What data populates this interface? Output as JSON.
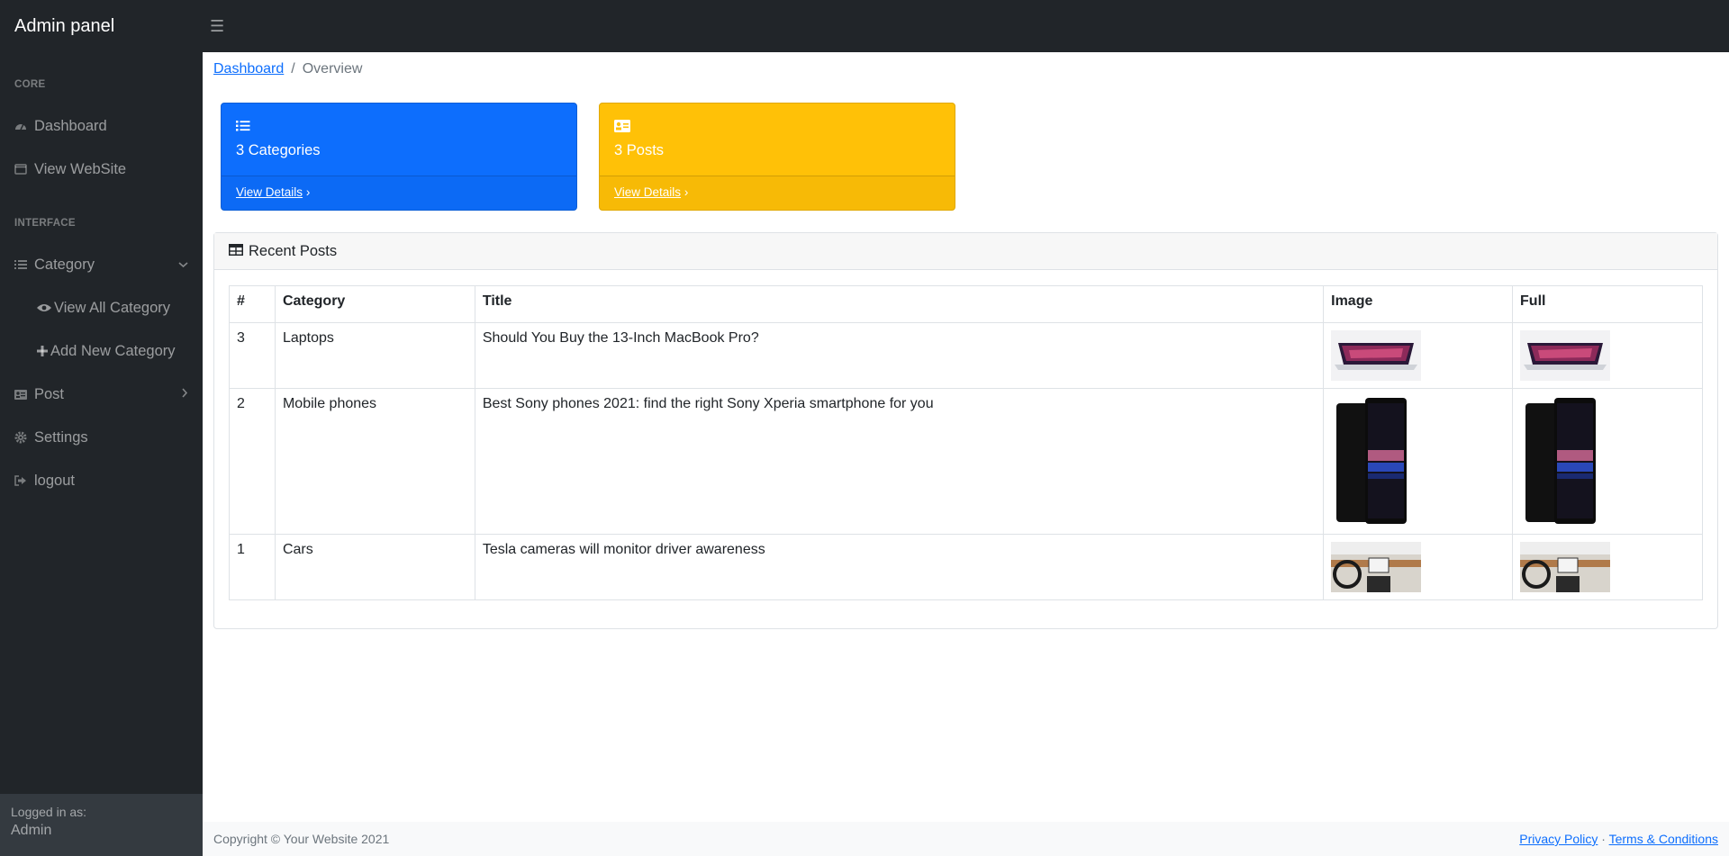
{
  "brand": "Admin panel",
  "toggle_icon": "hamburger-menu-icon",
  "sidebar": {
    "heading_core": "CORE",
    "heading_interface": "INTERFACE",
    "items": [
      {
        "label": "Dashboard",
        "icon": "tachometer-icon"
      },
      {
        "label": "View WebSite",
        "icon": "window-icon"
      },
      {
        "label": "Category",
        "icon": "list-icon"
      },
      {
        "label": "View All Category",
        "icon": "eye-icon"
      },
      {
        "label": "Add New Category",
        "icon": "plus-icon"
      },
      {
        "label": "Post",
        "icon": "id-card-icon"
      },
      {
        "label": "Settings",
        "icon": "gear-icon"
      },
      {
        "label": "logout",
        "icon": "sign-out-icon"
      }
    ],
    "footer_label": "Logged in as:",
    "footer_user": "Admin"
  },
  "breadcrumb": {
    "link": "Dashboard",
    "separator": "/",
    "current": "Overview"
  },
  "stats": [
    {
      "label": "3 Categories",
      "link": "View Details",
      "color": "#0d6efd"
    },
    {
      "label": "3 Posts",
      "link": "View Details",
      "color": "#ffc107"
    }
  ],
  "recent": {
    "title": "Recent Posts",
    "columns": [
      "#",
      "Category",
      "Title",
      "Image",
      "Full"
    ],
    "rows": [
      {
        "id": "3",
        "category": "Laptops",
        "title": "Should You Buy the 13-Inch MacBook Pro?"
      },
      {
        "id": "2",
        "category": "Mobile phones",
        "title": "Best Sony phones 2021: find the right Sony Xperia smartphone for you"
      },
      {
        "id": "1",
        "category": "Cars",
        "title": "Tesla cameras will monitor driver awareness"
      }
    ]
  },
  "footer": {
    "copyright": "Copyright © Your Website 2021",
    "privacy": "Privacy Policy",
    "dot": "·",
    "terms": "Terms & Conditions"
  }
}
